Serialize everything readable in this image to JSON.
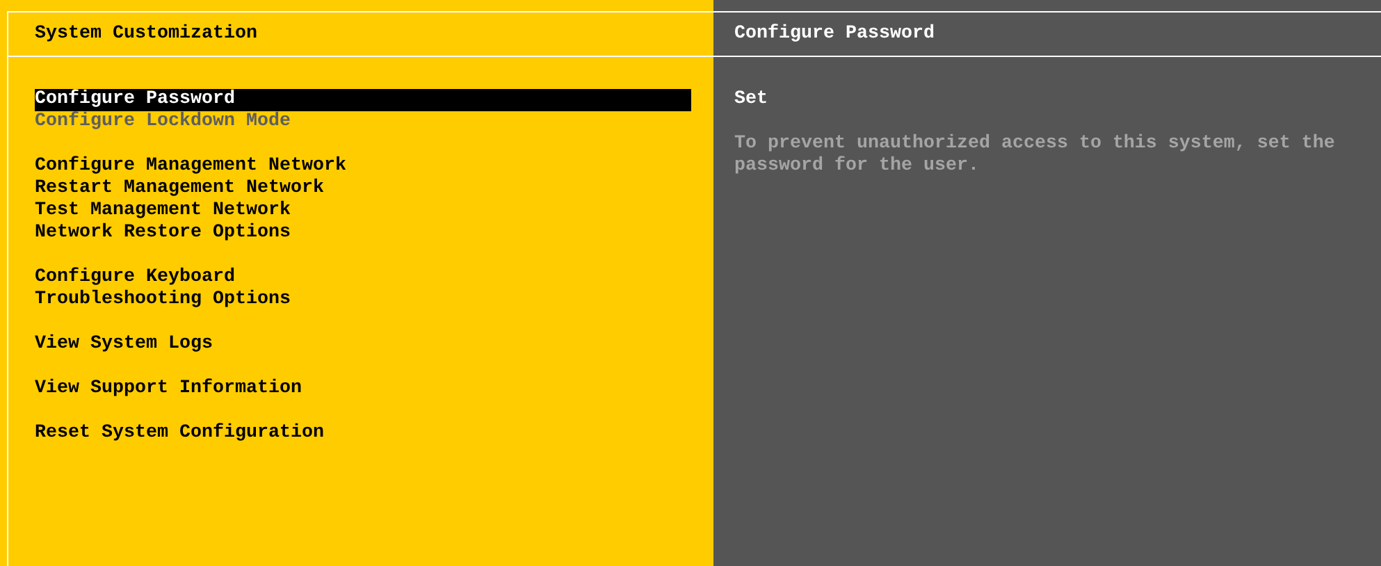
{
  "left_panel": {
    "title": "System Customization",
    "menu_groups": [
      [
        {
          "label": "Configure Password",
          "selected": true,
          "disabled": false
        },
        {
          "label": "Configure Lockdown Mode",
          "selected": false,
          "disabled": true
        }
      ],
      [
        {
          "label": "Configure Management Network",
          "selected": false,
          "disabled": false
        },
        {
          "label": "Restart Management Network",
          "selected": false,
          "disabled": false
        },
        {
          "label": "Test Management Network",
          "selected": false,
          "disabled": false
        },
        {
          "label": "Network Restore Options",
          "selected": false,
          "disabled": false
        }
      ],
      [
        {
          "label": "Configure Keyboard",
          "selected": false,
          "disabled": false
        },
        {
          "label": "Troubleshooting Options",
          "selected": false,
          "disabled": false
        }
      ],
      [
        {
          "label": "View System Logs",
          "selected": false,
          "disabled": false
        }
      ],
      [
        {
          "label": "View Support Information",
          "selected": false,
          "disabled": false
        }
      ],
      [
        {
          "label": "Reset System Configuration",
          "selected": false,
          "disabled": false
        }
      ]
    ]
  },
  "right_panel": {
    "title": "Configure Password",
    "status": "Set",
    "description": "To prevent unauthorized access to this system, set the password for the user."
  }
}
